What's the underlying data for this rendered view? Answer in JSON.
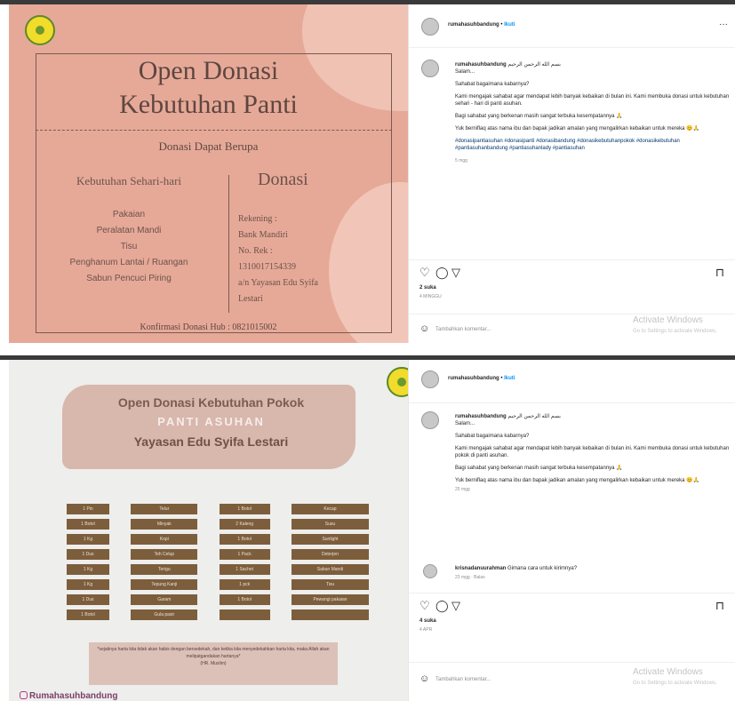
{
  "post1": {
    "image": {
      "title_line1": "Open Donasi",
      "title_line2": "Kebutuhan Panti",
      "subtitle": "Donasi Dapat Berupa",
      "left_heading": "Kebutuhan Sehari-hari",
      "items": [
        "Pakaian",
        "Peralatan Mandi",
        "Tisu",
        "Penghanum Lantai / Ruangan",
        "Sabun Pencuci Piring"
      ],
      "right_heading": "Donasi",
      "bank_lines": [
        "Rekening :",
        "Bank Mandiri",
        "No. Rek :",
        "1310017154339",
        "a/n Yayasan Edu Syifa",
        "Lestari"
      ],
      "footer": "Konfirmasi Donasi Hub : 0821015002"
    },
    "header": {
      "username": "rumahasuhbandung",
      "separator": "•",
      "follow": "Ikuti",
      "more": "···"
    },
    "caption": {
      "username": "rumahasuhbandung",
      "arabic": "بسم الله الرحمن الرحيم",
      "paragraphs": [
        "Salam...",
        "Sahabat bagaimana kabarnya?",
        "Kami mengajak sahabat agar mendapat lebih banyak kebaikan di bulan ini. Kami membuka donasi untuk kebutuhan sehari - hari di panti asuhan.",
        "Bagi sahabat yang berkenan masih sangat terbuka kesempatannya 🙏",
        "Yuk berniflaq atas nama ibu dan bapak jadikan amalan yang mengalirkan kebaikan untuk mereka 😊🙏"
      ],
      "hashtags": "#donasipantiasuhan #donasipanti #donasibandung #donasikebutuhanpokok #donasikebutuhan #pantiasuhanbandung #pantiasuhanlady #pantiasuhan",
      "time": "5 mgg"
    },
    "likes": "2 suka",
    "date": "4 MINGGU",
    "comment_placeholder": "Tambahkan komentar...",
    "watermark": {
      "line1": "Activate Windows",
      "line2": "Go to Settings to activate Windows."
    }
  },
  "post2": {
    "image": {
      "title1": "Open Donasi Kebutuhan Pokok",
      "title2": "PANTI ASUHAN",
      "title3": "Yayasan Edu Syifa Lestari",
      "rows": [
        [
          "1 Pin",
          "Telur",
          "1 Botol",
          "Kecap"
        ],
        [
          "1 Botol",
          "Minyak",
          "2 Kaleng",
          "Susu"
        ],
        [
          "1 Kg",
          "Kopi",
          "1 Botol",
          "Sunlight"
        ],
        [
          "1 Dus",
          "Teh Celup",
          "1 Pack",
          "Deterjen"
        ],
        [
          "1 Kg",
          "Terigu",
          "1 Sachet",
          "Sabun Mandi"
        ],
        [
          "1 Kg",
          "Tepung Kanji",
          "1 pck",
          "Tisu"
        ],
        [
          "1 Dus",
          "Garam",
          "1 Botol",
          "Pewangi pakaian"
        ],
        [
          "1 Botol",
          "Gula pasir",
          "",
          ""
        ]
      ],
      "note": "*sejatinya harta kita tidak akan habis dengan bersedekah, dan ketika kita menyedekahkan harta kita, maka Allah akan melipatgandakan hartanya*",
      "note_source": "(HR. Muslim)",
      "brand": "Rumahasuhbandung"
    },
    "header": {
      "username": "rumahasuhbandung",
      "separator": "•",
      "follow": "Ikuti"
    },
    "caption": {
      "username": "rumahasuhbandung",
      "arabic": "بسم الله الرحمن الرحيم",
      "paragraphs": [
        "Salam...",
        "Sahabat bagaimana kabarnya?",
        "Kami mengajak sahabat agar mendapat lebih banyak kebaikan di bulan ini. Kami membuka donasi untuk kebutuhan pokok di panti asuhan.",
        "Bagi sahabat yang berkenan masih sangat terbuka kesempatannya 🙏",
        "Yuk berniflaq atas nama ibu dan bapak jadikan amalan yang mengalirkan kebaikan untuk mereka 😊🙏"
      ],
      "time": "25 mgg"
    },
    "comment": {
      "username": "krisnadanuurahman",
      "text": "Gimana cara untuk kirimnya?",
      "time": "23 mgg",
      "reply": "Balas"
    },
    "likes": "4 suka",
    "date": "4 APR",
    "comment_placeholder": "Tambahkan komentar...",
    "watermark": {
      "line1": "Activate Windows",
      "line2": "Go to Settings to activate Windows."
    }
  },
  "icons": {
    "like": "heart-icon",
    "comment": "comment-icon",
    "share": "send-icon",
    "save": "bookmark-icon",
    "emoji": "emoji-icon",
    "more": "more-icon",
    "logo": "yayasan-logo"
  }
}
